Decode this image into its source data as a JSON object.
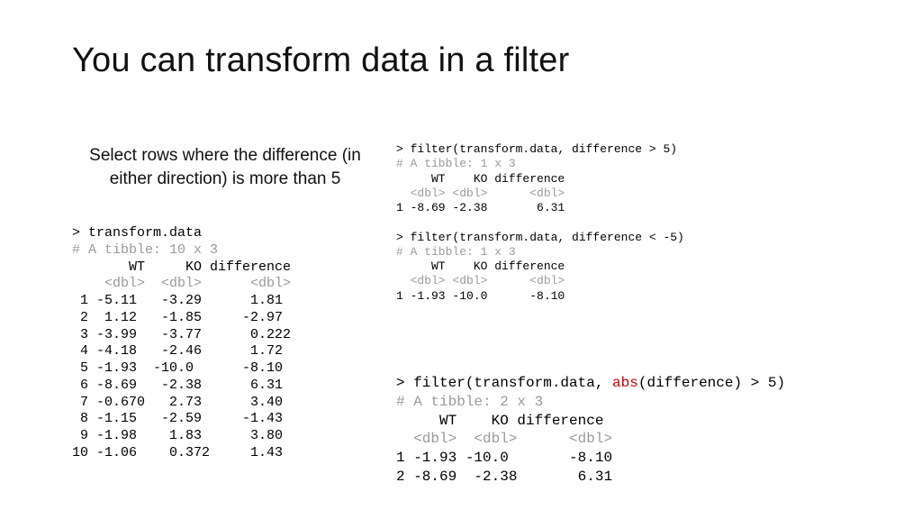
{
  "title": "You can transform data in a filter",
  "subtitle": "Select rows where the difference (in either direction) is more than 5",
  "left": {
    "prompt": "> transform.data",
    "tibble": "# A tibble: 10 x 3",
    "header": "       WT     KO difference",
    "types": "    <dbl>  <dbl>      <dbl>",
    "rows": [
      " 1 -5.11   -3.29      1.81 ",
      " 2  1.12   -1.85     -2.97 ",
      " 3 -3.99   -3.77      0.222",
      " 4 -4.18   -2.46      1.72 ",
      " 5 -1.93  -10.0      -8.10 ",
      " 6 -8.69   -2.38      6.31 ",
      " 7 -0.670   2.73      3.40 ",
      " 8 -1.15   -2.59     -1.43 ",
      " 9 -1.98    1.83      3.80 ",
      "10 -1.06    0.372     1.43 "
    ]
  },
  "top1": {
    "prompt": "> filter(transform.data, difference > 5)",
    "tibble": "# A tibble: 1 x 3",
    "header": "     WT    KO difference",
    "types": "  <dbl> <dbl>      <dbl>",
    "row": "1 -8.69 -2.38       6.31"
  },
  "top2": {
    "prompt": "> filter(transform.data, difference < -5)",
    "tibble": "# A tibble: 1 x 3",
    "header": "     WT    KO difference",
    "types": "  <dbl> <dbl>      <dbl>",
    "row": "1 -1.93 -10.0      -8.10"
  },
  "bottom": {
    "prompt_pre": "> filter(transform.data, ",
    "prompt_hl": "abs",
    "prompt_post": "(difference) > 5)",
    "tibble": "# A tibble: 2 x 3",
    "header": "     WT    KO difference",
    "types": "  <dbl>  <dbl>      <dbl>",
    "row1": "1 -1.93 -10.0       -8.10",
    "row2": "2 -8.69  -2.38       6.31"
  }
}
